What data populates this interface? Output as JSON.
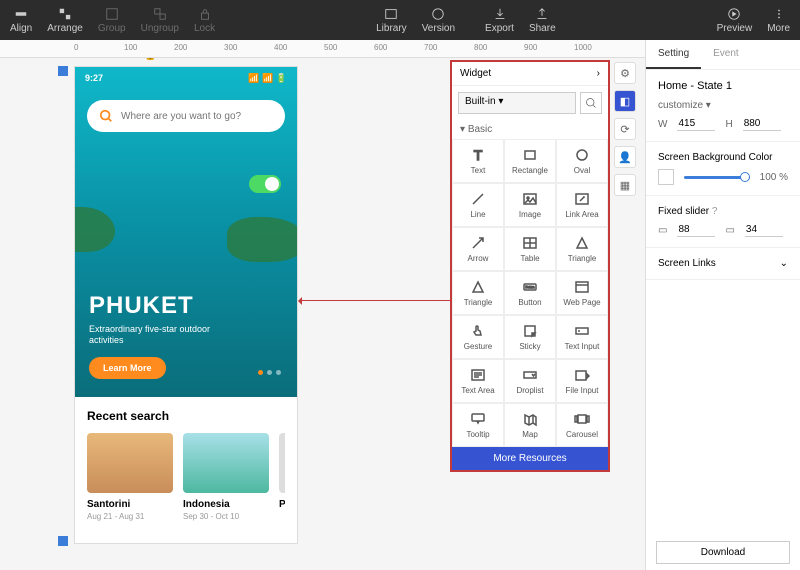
{
  "topbar": {
    "align": "Align",
    "arrange": "Arrange",
    "group": "Group",
    "ungroup": "Ungroup",
    "lock": "Lock",
    "library": "Library",
    "version": "Version",
    "export": "Export",
    "share": "Share",
    "preview": "Preview",
    "more": "More"
  },
  "ruler_marks": [
    "0",
    "100",
    "200",
    "300",
    "400",
    "500",
    "600",
    "700",
    "800",
    "900",
    "1000"
  ],
  "mockup_label": "Home - State 1",
  "mockup": {
    "time": "9:27",
    "search_placeholder": "Where are you want to go?",
    "hero_title": "PHUKET",
    "hero_sub": "Extraordinary five-star outdoor activities",
    "learn_more": "Learn More",
    "recent_title": "Recent search",
    "cards": [
      {
        "name": "Santorini",
        "date": "Aug 21 - Aug 31",
        "bg": "linear-gradient(180deg,#e8b87a,#c98d5a)"
      },
      {
        "name": "Indonesia",
        "date": "Sep 30 - Oct 10",
        "bg": "linear-gradient(180deg,#a8e0e8,#4db8a0)"
      },
      {
        "name": "Paris",
        "date": "",
        "bg": "#ddd"
      }
    ]
  },
  "widget": {
    "header": "Widget",
    "builtin": "Built-in",
    "basic": "Basic",
    "items": [
      "Text",
      "Rectangle",
      "Oval",
      "Line",
      "Image",
      "Link Area",
      "Arrow",
      "Table",
      "Triangle",
      "Triangle",
      "Button",
      "Web Page",
      "Gesture",
      "Sticky",
      "Text Input",
      "Text Area",
      "Droplist",
      "File Input",
      "Tooltip",
      "Map",
      "Carousel"
    ],
    "more": "More Resources"
  },
  "right": {
    "tab_setting": "Setting",
    "tab_event": "Event",
    "state_name": "Home - State 1",
    "customize": "customize",
    "w_label": "W",
    "w_val": "415",
    "h_label": "H",
    "h_val": "880",
    "bgcolor_label": "Screen Background Color",
    "bg_pct": "100 %",
    "fixed_slider_label": "Fixed slider",
    "fs_top": "88",
    "fs_bot": "34",
    "screen_links": "Screen Links",
    "download": "Download"
  }
}
